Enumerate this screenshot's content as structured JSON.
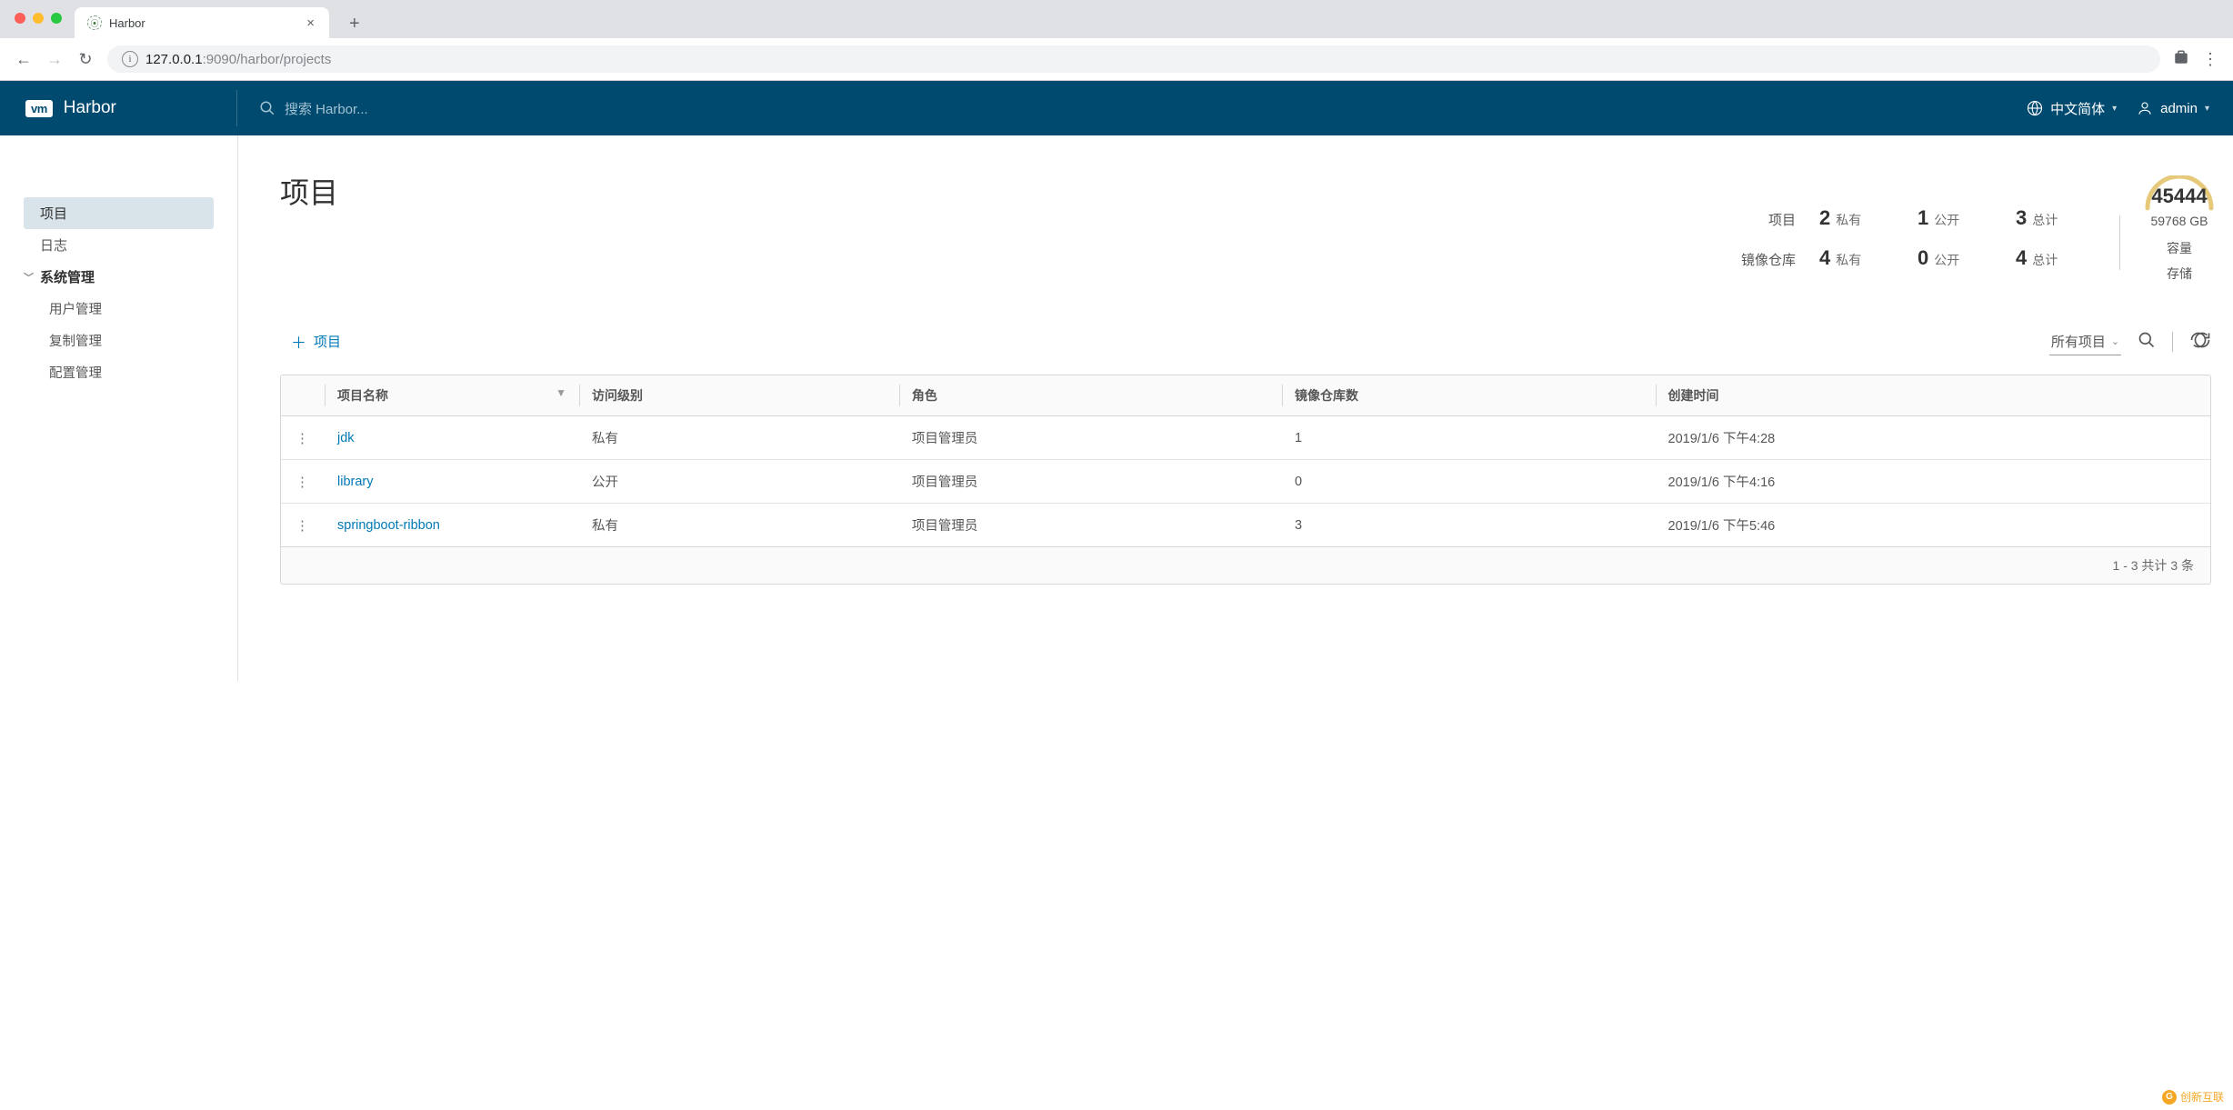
{
  "browser": {
    "tab_title": "Harbor",
    "url_host": "127.0.0.1",
    "url_port": ":9090",
    "url_path": "/harbor/projects"
  },
  "header": {
    "brand": "Harbor",
    "logo_text": "vm",
    "search_placeholder": "搜索 Harbor...",
    "language": "中文简体",
    "user": "admin"
  },
  "sidebar": {
    "items": [
      {
        "label": "项目",
        "active": true
      },
      {
        "label": "日志",
        "active": false
      },
      {
        "label": "系统管理",
        "active": false,
        "group": true
      },
      {
        "label": "用户管理",
        "active": false,
        "sub": true
      },
      {
        "label": "复制管理",
        "active": false,
        "sub": true
      },
      {
        "label": "配置管理",
        "active": false,
        "sub": true
      }
    ]
  },
  "page": {
    "title": "项目",
    "stats": {
      "row1_label": "项目",
      "row2_label": "镜像仓库",
      "cols": {
        "private_word": "私有",
        "public_word": "公开",
        "total_word": "总计"
      },
      "projects": {
        "private": "2",
        "public": "1",
        "total": "3"
      },
      "repos": {
        "private": "4",
        "public": "0",
        "total": "4"
      }
    },
    "storage": {
      "gauge_value": "45444",
      "total": "59768 GB",
      "capacity_label": "容量",
      "storage_label": "存储"
    },
    "toolbar": {
      "new_project": "项目",
      "filter_label": "所有项目"
    },
    "table": {
      "columns": {
        "name": "项目名称",
        "access": "访问级别",
        "role": "角色",
        "repo_count": "镜像仓库数",
        "created": "创建时间"
      },
      "rows": [
        {
          "name": "jdk",
          "access": "私有",
          "role": "项目管理员",
          "repos": "1",
          "created": "2019/1/6 下午4:28"
        },
        {
          "name": "library",
          "access": "公开",
          "role": "项目管理员",
          "repos": "0",
          "created": "2019/1/6 下午4:16"
        },
        {
          "name": "springboot-ribbon",
          "access": "私有",
          "role": "项目管理员",
          "repos": "3",
          "created": "2019/1/6 下午5:46"
        }
      ],
      "footer": "1 - 3 共计 3 条"
    }
  },
  "watermark": "创新互联"
}
